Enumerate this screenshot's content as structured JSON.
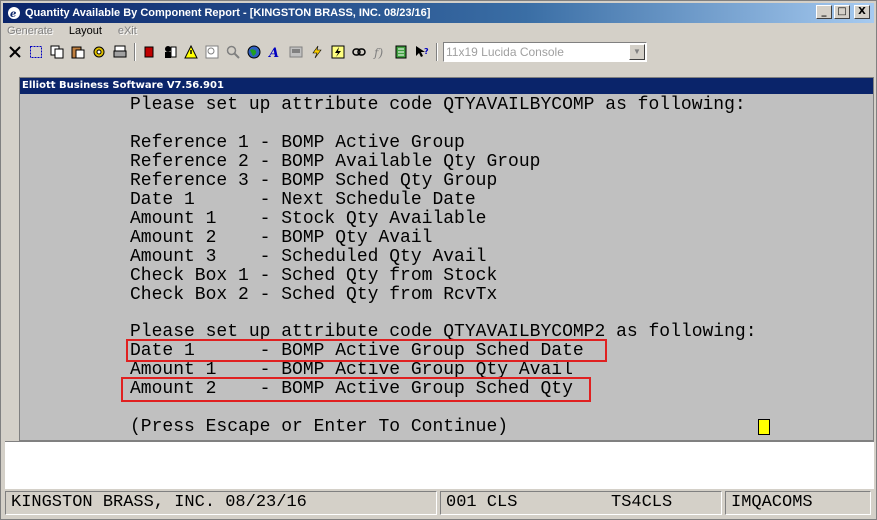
{
  "window": {
    "title": "Quantity Available By Component Report - [KINGSTON BRASS, INC. 08/23/16]",
    "controls": {
      "minimize": "_",
      "maximize": "□",
      "close": "X"
    }
  },
  "menu": {
    "generate": "Generate",
    "layout": "Layout",
    "exit": "eXit"
  },
  "toolbar": {
    "icons": [
      "close-x-icon",
      "select-icon",
      "copy-icon",
      "paste-icon",
      "settings-icon",
      "print-icon",
      "stop-icon",
      "users-icon",
      "alert-icon",
      "zoom-icon",
      "search-icon",
      "earth-icon",
      "font-icon",
      "keyboard-icon",
      "lightning-icon",
      "macro-icon",
      "link-icon",
      "function-icon",
      "notes-icon",
      "help-pointer-icon"
    ],
    "font_select_value": "11x19 Lucida Console"
  },
  "inner": {
    "title": "Elliott Business Software V7.56.901"
  },
  "terminal": {
    "lines": [
      "Please set up attribute code QTYAVAILBYCOMP as following:",
      "",
      "Reference 1 - BOMP Active Group",
      "Reference 2 - BOMP Available Qty Group",
      "Reference 3 - BOMP Sched Qty Group",
      "Date 1      - Next Schedule Date",
      "Amount 1    - Stock Qty Available",
      "Amount 2    - BOMP Qty Avail",
      "Amount 3    - Scheduled Qty Avail",
      "Check Box 1 - Sched Qty from Stock",
      "Check Box 2 - Sched Qty from RcvTx",
      "",
      "Please set up attribute code QTYAVAILBYCOMP2 as following:",
      "Date 1      - BOMP Active Group Sched Date",
      "Amount 1    - BOMP Active Group Qty Avail",
      "Amount 2    - BOMP Active Group Sched Qty",
      "",
      "(Press Escape or Enter To Continue)"
    ]
  },
  "status": {
    "company": "KINGSTON BRASS, INC. 08/23/16",
    "terminal_code": "001 CLS",
    "server": "TS4CLS",
    "user": "IMQACOMS"
  },
  "colors": {
    "highlight": "#e02020",
    "cursor": "#ffff00",
    "title_bar": "#0a246a"
  }
}
